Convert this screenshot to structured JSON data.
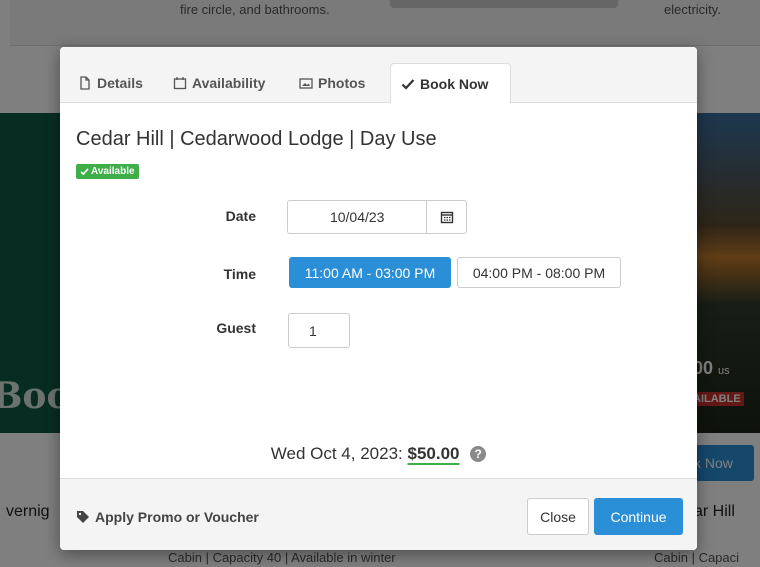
{
  "background": {
    "top_left_text": "fire circle, and bathrooms.",
    "top_right_text": "electricity.",
    "left_image_text": "Boo",
    "right_price": ".00",
    "right_price_unit": "us",
    "right_badge": "AILABLE",
    "right_button": "k Now",
    "left_title": "vernig",
    "right_title": "ar Hill",
    "bottom_left_text": "Cabin | Capacity 40 | Available in winter",
    "bottom_right_text": "Cabin | Capaci"
  },
  "modal": {
    "tabs": [
      {
        "label": "Details",
        "icon": "file-icon"
      },
      {
        "label": "Availability",
        "icon": "calendar-icon"
      },
      {
        "label": "Photos",
        "icon": "image-icon"
      },
      {
        "label": "Book Now",
        "icon": "check-icon"
      }
    ],
    "active_tab": "Book Now",
    "title": "Cedar Hill | Cedarwood Lodge | Day Use",
    "status_badge": "Available",
    "form": {
      "date_label": "Date",
      "date_value": "10/04/23",
      "time_label": "Time",
      "time_options": [
        "11:00 AM - 03:00 PM",
        "04:00 PM - 08:00 PM"
      ],
      "time_selected": "11:00 AM - 03:00 PM",
      "guest_label": "Guest",
      "guest_value": "1"
    },
    "total_date": "Wed Oct 4, 2023:",
    "total_price": "$50.00",
    "help_glyph": "?",
    "footer": {
      "promo_label": "Apply Promo or Voucher",
      "close_label": "Close",
      "continue_label": "Continue"
    }
  },
  "colors": {
    "primary": "#2a8fd6",
    "success": "#3fae49",
    "danger": "#c9302c"
  }
}
